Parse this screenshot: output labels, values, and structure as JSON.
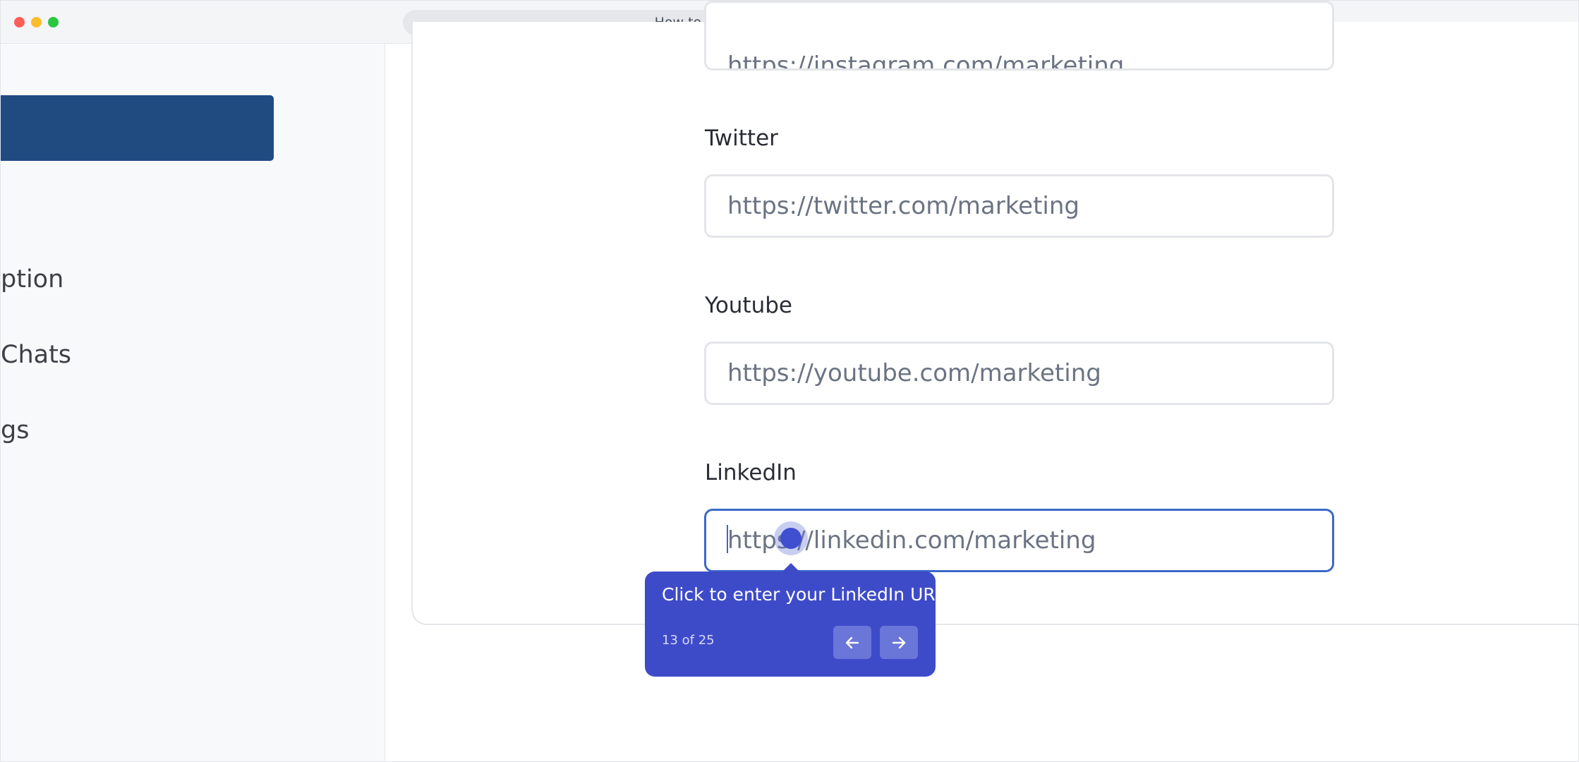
{
  "window": {
    "title": "How to update your profile details easily"
  },
  "sidebar": {
    "items": [
      {
        "label": "ption"
      },
      {
        "label": "Chats"
      },
      {
        "label": "gs"
      }
    ]
  },
  "form": {
    "instagram": {
      "value": "https://instagram.com/marketing"
    },
    "twitter": {
      "label": "Twitter",
      "value": "https://twitter.com/marketing"
    },
    "youtube": {
      "label": "Youtube",
      "value": "https://youtube.com/marketing"
    },
    "linkedin": {
      "label": "LinkedIn",
      "value": "https://linkedin.com/marketing"
    }
  },
  "tooltip": {
    "text": "Click to enter your LinkedIn URL.",
    "step": "13 of 25",
    "prev_icon": "arrow-left-icon",
    "next_icon": "arrow-right-icon"
  },
  "colors": {
    "accent": "#3e4bc9",
    "sidebar_active": "#1f4b80",
    "focus_border": "#3c68c8"
  }
}
